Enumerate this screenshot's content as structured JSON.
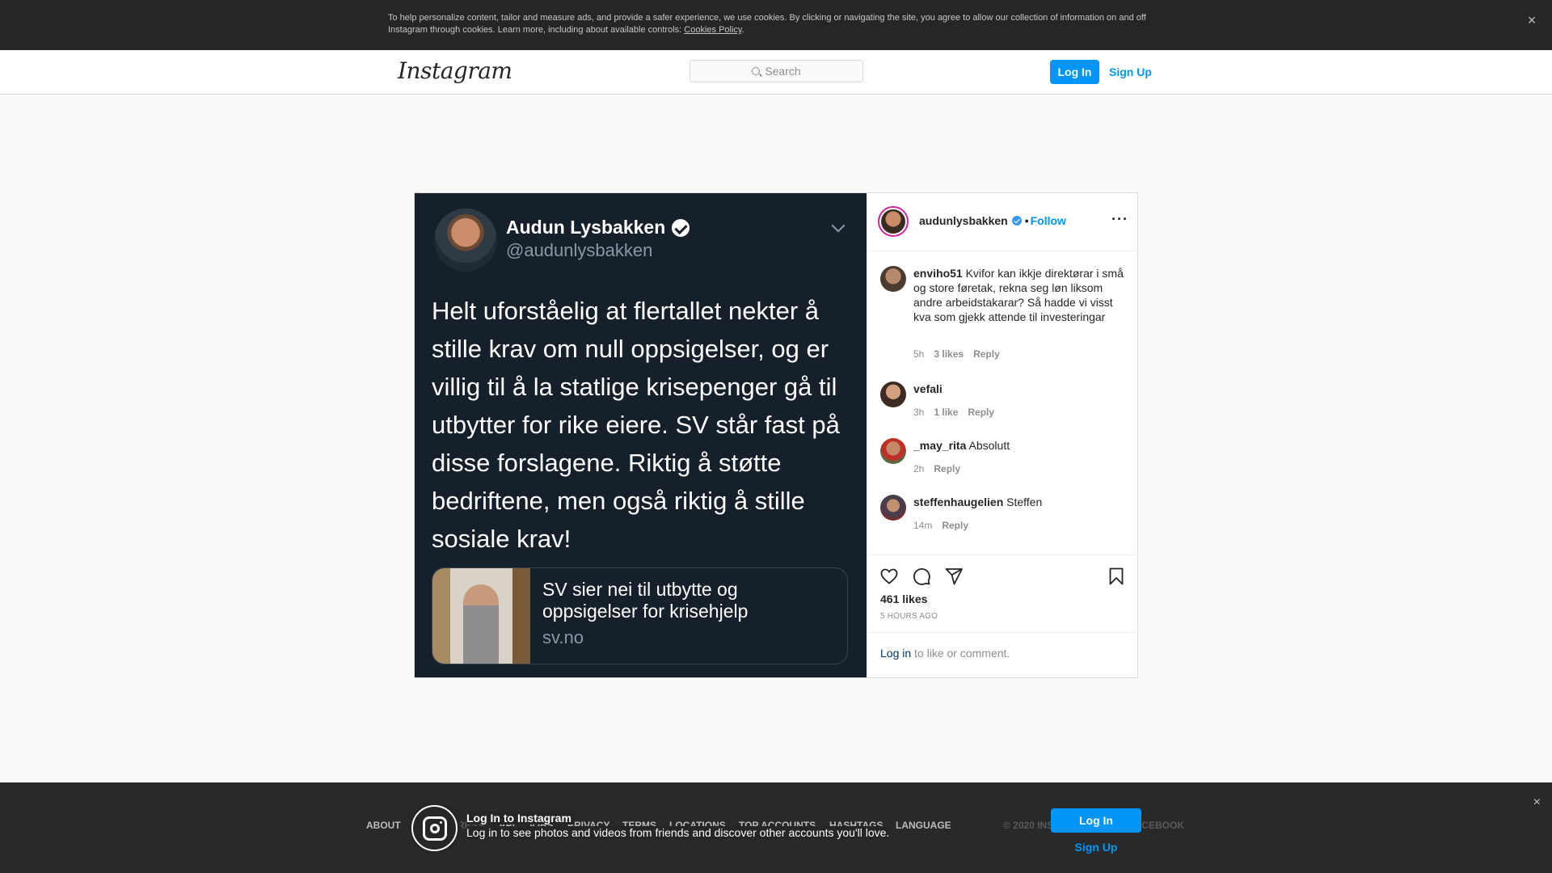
{
  "cookie_banner": {
    "text": "To help personalize content, tailor and measure ads, and provide a safer experience, we use cookies. By clicking or navigating the site, you agree to allow our collection of information on and off Instagram through cookies. Learn more, including about available controls: ",
    "link": "Cookies Policy",
    "period": ".",
    "close": "×"
  },
  "nav": {
    "logo": "Instagram",
    "search_placeholder": "Search",
    "login": "Log In",
    "signup": "Sign Up"
  },
  "tweet": {
    "name": "Audun Lysbakken",
    "handle": "@audunlysbakken",
    "text": "Helt uforståelig at flertallet nekter å stille krav om null oppsigelser, og er villig til å la statlige krisepenger gå til utbytter for rike eiere. SV står fast på disse forslagene. Riktig å støtte bedriftene, men også riktig å stille sosiale krav!",
    "card_title": "SV sier nei til utbytte og oppsigelser for krisehjelp",
    "card_domain": "sv.no"
  },
  "post_header": {
    "username": "audunlysbakken",
    "separator": "•",
    "follow": "Follow",
    "more": "···"
  },
  "comments": [
    {
      "user": "enviho51",
      "text": "Kvifor kan ikkje direktørar i små og store føretak, rekna seg løn liksom andre arbeidstakarar? Så hadde vi visst kva som gjekk attende til investeringar",
      "time": "5h",
      "likes": "3 likes",
      "reply": "Reply"
    },
    {
      "user": "vefali",
      "text": "      ",
      "time": "3h",
      "likes": "1 like",
      "reply": "Reply"
    },
    {
      "user": "_may_rita",
      "text": "Absolutt  ",
      "time": "2h",
      "likes": "",
      "reply": "Reply"
    },
    {
      "user": "steffenhaugelien",
      "text": "Steffen ",
      "time": "14m",
      "likes": "",
      "reply": "Reply"
    }
  ],
  "actions": {
    "likes": "461 likes",
    "time": "5 HOURS AGO",
    "login_link": "Log in",
    "login_rest": " to like or comment."
  },
  "footer": {
    "links": [
      "ABOUT",
      "PRESS",
      "API",
      "JOBS",
      "PRIVACY",
      "TERMS",
      "LOCATIONS",
      "TOP ACCOUNTS",
      "HASHTAGS",
      "LANGUAGE"
    ],
    "copyright": "© 2020 INSTAGRAM FROM FACEBOOK"
  },
  "bottom_bar": {
    "title": "Log In to Instagram",
    "subtitle": "Log in to see photos and videos from friends and discover other accounts you'll love.",
    "login": "Log In",
    "signup": "Sign Up",
    "close": "×"
  },
  "colors": {
    "accent": "#0095f6",
    "tweet_bg": "#15202b"
  }
}
